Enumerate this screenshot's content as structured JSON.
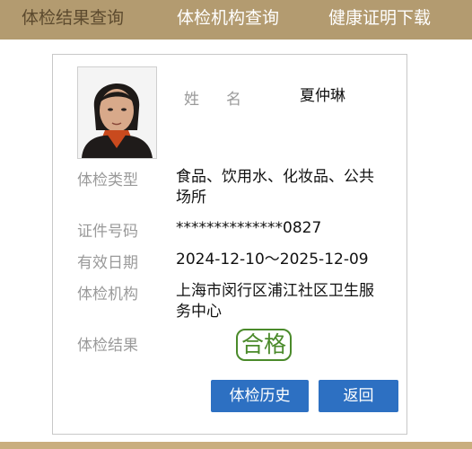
{
  "nav": {
    "tabs": [
      {
        "label": "体检结果查询"
      },
      {
        "label": "体检机构查询"
      },
      {
        "label": "健康证明下载"
      }
    ]
  },
  "card": {
    "name_label_1": "姓",
    "name_label_2": "名",
    "name_value": "夏仲琳",
    "fields": {
      "type_label": "体检类型",
      "type_value": "食品、饮用水、化妆品、公共场所",
      "id_label": "证件号码",
      "id_value": "**************0827",
      "date_label": "有效日期",
      "date_value": "2024-12-10～2025-12-09",
      "org_label": "体检机构",
      "org_value": "上海市闵行区浦江社区卫生服务中心",
      "result_label": "体检结果",
      "result_value": "合格"
    },
    "buttons": {
      "history": "体检历史",
      "back": "返回"
    }
  },
  "colors": {
    "nav_bg": "#b39b70",
    "frame": "#c9ae7e",
    "button": "#2d70c2",
    "stamp": "#4a8a2a"
  }
}
